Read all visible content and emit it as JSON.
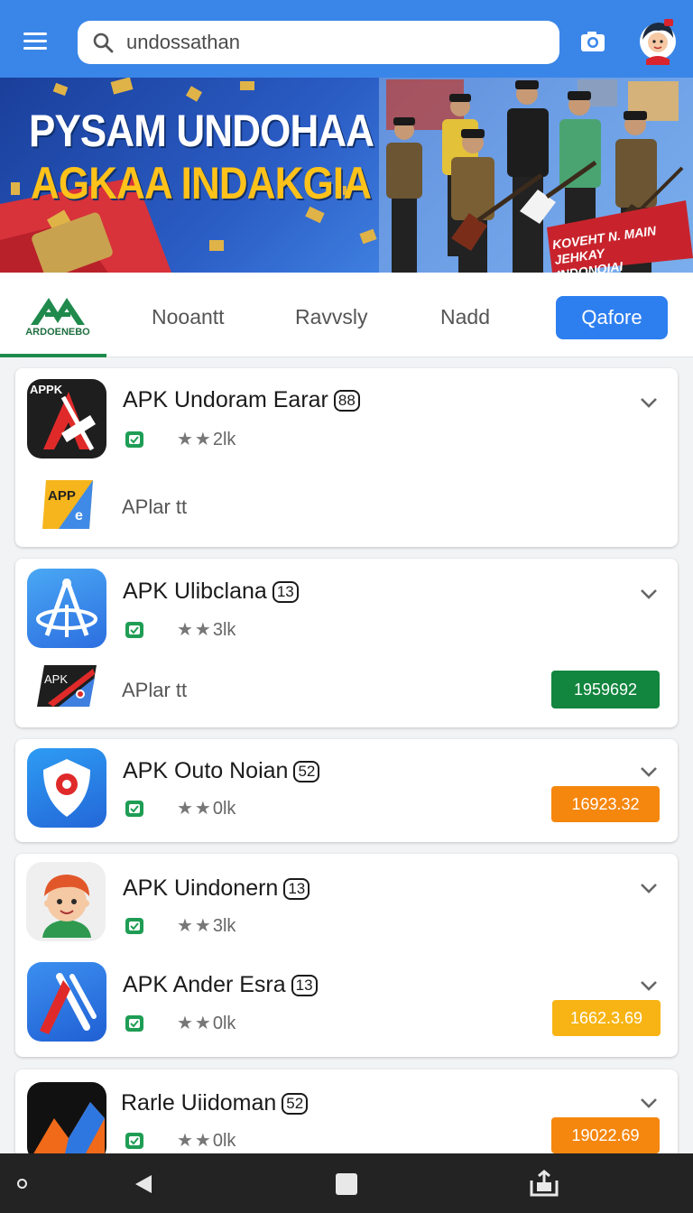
{
  "search": {
    "value": "undossathan",
    "placeholder": "undossathan"
  },
  "icons": {
    "menu": "menu-icon",
    "search": "search-icon",
    "camera": "camera-icon",
    "avatar": "avatar-icon",
    "chevron": "chevron-down-icon",
    "verified": "shield-check-icon"
  },
  "banner": {
    "line1": "PYSAM UNDOHAA",
    "line2": "AGKAA INDAKGIA",
    "tag": "KOVEHT N. MAIN JEHKAY INDONOIAI"
  },
  "tabs": {
    "logo_label": "ARDOENEBO",
    "items": [
      "Nooantt",
      "Ravvsly",
      "Nadd"
    ],
    "active": "Qafore"
  },
  "apps": [
    {
      "title": "APK Undoram Earar",
      "badge": "88",
      "rating": "2lk",
      "sub_label": "APlar tt",
      "sub_icon_text": "APP",
      "icon_text": "APPK"
    },
    {
      "title": "APK Ulibclana",
      "badge": "13",
      "rating": "3lk",
      "sub_label": "APlar tt",
      "sub_icon_text": "APK",
      "price": "1959692"
    },
    {
      "title": "APK Outo Noian",
      "badge": "52",
      "rating": "0lk",
      "price": "16923.32"
    },
    {
      "title": "APK Uindonern",
      "badge": "13",
      "rating": "3lk"
    },
    {
      "title": "APK Ander Esra",
      "badge": "13",
      "rating": "0lk",
      "price": "1662.3.69"
    },
    {
      "title": "Rarle Uiidoman",
      "badge": "52",
      "rating": "0lk",
      "price": "19022.69"
    }
  ],
  "colors": {
    "topbar": "#3a86e8",
    "active_tab": "#2d7ff0",
    "price_green": "#12853e",
    "price_orange": "#f5870f",
    "price_yellow": "#f8b414",
    "verified_green": "#1f9d55"
  }
}
